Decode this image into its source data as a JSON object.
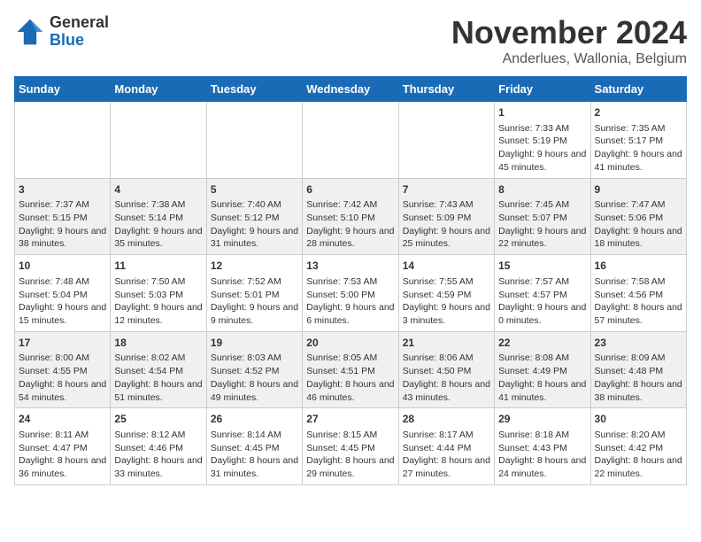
{
  "logo": {
    "general": "General",
    "blue": "Blue"
  },
  "title": "November 2024",
  "location": "Anderlues, Wallonia, Belgium",
  "days_of_week": [
    "Sunday",
    "Monday",
    "Tuesday",
    "Wednesday",
    "Thursday",
    "Friday",
    "Saturday"
  ],
  "weeks": [
    [
      {
        "day": "",
        "sunrise": "",
        "sunset": "",
        "daylight": ""
      },
      {
        "day": "",
        "sunrise": "",
        "sunset": "",
        "daylight": ""
      },
      {
        "day": "",
        "sunrise": "",
        "sunset": "",
        "daylight": ""
      },
      {
        "day": "",
        "sunrise": "",
        "sunset": "",
        "daylight": ""
      },
      {
        "day": "",
        "sunrise": "",
        "sunset": "",
        "daylight": ""
      },
      {
        "day": "1",
        "sunrise": "Sunrise: 7:33 AM",
        "sunset": "Sunset: 5:19 PM",
        "daylight": "Daylight: 9 hours and 45 minutes."
      },
      {
        "day": "2",
        "sunrise": "Sunrise: 7:35 AM",
        "sunset": "Sunset: 5:17 PM",
        "daylight": "Daylight: 9 hours and 41 minutes."
      }
    ],
    [
      {
        "day": "3",
        "sunrise": "Sunrise: 7:37 AM",
        "sunset": "Sunset: 5:15 PM",
        "daylight": "Daylight: 9 hours and 38 minutes."
      },
      {
        "day": "4",
        "sunrise": "Sunrise: 7:38 AM",
        "sunset": "Sunset: 5:14 PM",
        "daylight": "Daylight: 9 hours and 35 minutes."
      },
      {
        "day": "5",
        "sunrise": "Sunrise: 7:40 AM",
        "sunset": "Sunset: 5:12 PM",
        "daylight": "Daylight: 9 hours and 31 minutes."
      },
      {
        "day": "6",
        "sunrise": "Sunrise: 7:42 AM",
        "sunset": "Sunset: 5:10 PM",
        "daylight": "Daylight: 9 hours and 28 minutes."
      },
      {
        "day": "7",
        "sunrise": "Sunrise: 7:43 AM",
        "sunset": "Sunset: 5:09 PM",
        "daylight": "Daylight: 9 hours and 25 minutes."
      },
      {
        "day": "8",
        "sunrise": "Sunrise: 7:45 AM",
        "sunset": "Sunset: 5:07 PM",
        "daylight": "Daylight: 9 hours and 22 minutes."
      },
      {
        "day": "9",
        "sunrise": "Sunrise: 7:47 AM",
        "sunset": "Sunset: 5:06 PM",
        "daylight": "Daylight: 9 hours and 18 minutes."
      }
    ],
    [
      {
        "day": "10",
        "sunrise": "Sunrise: 7:48 AM",
        "sunset": "Sunset: 5:04 PM",
        "daylight": "Daylight: 9 hours and 15 minutes."
      },
      {
        "day": "11",
        "sunrise": "Sunrise: 7:50 AM",
        "sunset": "Sunset: 5:03 PM",
        "daylight": "Daylight: 9 hours and 12 minutes."
      },
      {
        "day": "12",
        "sunrise": "Sunrise: 7:52 AM",
        "sunset": "Sunset: 5:01 PM",
        "daylight": "Daylight: 9 hours and 9 minutes."
      },
      {
        "day": "13",
        "sunrise": "Sunrise: 7:53 AM",
        "sunset": "Sunset: 5:00 PM",
        "daylight": "Daylight: 9 hours and 6 minutes."
      },
      {
        "day": "14",
        "sunrise": "Sunrise: 7:55 AM",
        "sunset": "Sunset: 4:59 PM",
        "daylight": "Daylight: 9 hours and 3 minutes."
      },
      {
        "day": "15",
        "sunrise": "Sunrise: 7:57 AM",
        "sunset": "Sunset: 4:57 PM",
        "daylight": "Daylight: 9 hours and 0 minutes."
      },
      {
        "day": "16",
        "sunrise": "Sunrise: 7:58 AM",
        "sunset": "Sunset: 4:56 PM",
        "daylight": "Daylight: 8 hours and 57 minutes."
      }
    ],
    [
      {
        "day": "17",
        "sunrise": "Sunrise: 8:00 AM",
        "sunset": "Sunset: 4:55 PM",
        "daylight": "Daylight: 8 hours and 54 minutes."
      },
      {
        "day": "18",
        "sunrise": "Sunrise: 8:02 AM",
        "sunset": "Sunset: 4:54 PM",
        "daylight": "Daylight: 8 hours and 51 minutes."
      },
      {
        "day": "19",
        "sunrise": "Sunrise: 8:03 AM",
        "sunset": "Sunset: 4:52 PM",
        "daylight": "Daylight: 8 hours and 49 minutes."
      },
      {
        "day": "20",
        "sunrise": "Sunrise: 8:05 AM",
        "sunset": "Sunset: 4:51 PM",
        "daylight": "Daylight: 8 hours and 46 minutes."
      },
      {
        "day": "21",
        "sunrise": "Sunrise: 8:06 AM",
        "sunset": "Sunset: 4:50 PM",
        "daylight": "Daylight: 8 hours and 43 minutes."
      },
      {
        "day": "22",
        "sunrise": "Sunrise: 8:08 AM",
        "sunset": "Sunset: 4:49 PM",
        "daylight": "Daylight: 8 hours and 41 minutes."
      },
      {
        "day": "23",
        "sunrise": "Sunrise: 8:09 AM",
        "sunset": "Sunset: 4:48 PM",
        "daylight": "Daylight: 8 hours and 38 minutes."
      }
    ],
    [
      {
        "day": "24",
        "sunrise": "Sunrise: 8:11 AM",
        "sunset": "Sunset: 4:47 PM",
        "daylight": "Daylight: 8 hours and 36 minutes."
      },
      {
        "day": "25",
        "sunrise": "Sunrise: 8:12 AM",
        "sunset": "Sunset: 4:46 PM",
        "daylight": "Daylight: 8 hours and 33 minutes."
      },
      {
        "day": "26",
        "sunrise": "Sunrise: 8:14 AM",
        "sunset": "Sunset: 4:45 PM",
        "daylight": "Daylight: 8 hours and 31 minutes."
      },
      {
        "day": "27",
        "sunrise": "Sunrise: 8:15 AM",
        "sunset": "Sunset: 4:45 PM",
        "daylight": "Daylight: 8 hours and 29 minutes."
      },
      {
        "day": "28",
        "sunrise": "Sunrise: 8:17 AM",
        "sunset": "Sunset: 4:44 PM",
        "daylight": "Daylight: 8 hours and 27 minutes."
      },
      {
        "day": "29",
        "sunrise": "Sunrise: 8:18 AM",
        "sunset": "Sunset: 4:43 PM",
        "daylight": "Daylight: 8 hours and 24 minutes."
      },
      {
        "day": "30",
        "sunrise": "Sunrise: 8:20 AM",
        "sunset": "Sunset: 4:42 PM",
        "daylight": "Daylight: 8 hours and 22 minutes."
      }
    ]
  ]
}
